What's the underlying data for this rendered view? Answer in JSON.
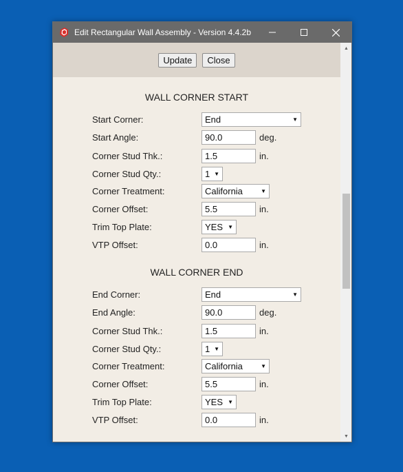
{
  "window": {
    "title": "Edit  Rectangular Wall Assembly - Version 4.4.2b"
  },
  "toolbar": {
    "update_label": "Update",
    "close_label": "Close"
  },
  "sections": {
    "start": {
      "title": "WALL CORNER START",
      "corner_label": "Start Corner:",
      "corner_value": "End",
      "angle_label": "Start Angle:",
      "angle_value": "90.0",
      "angle_unit": "deg.",
      "stud_thk_label": "Corner Stud Thk.:",
      "stud_thk_value": "1.5",
      "stud_thk_unit": "in.",
      "stud_qty_label": "Corner Stud Qty.:",
      "stud_qty_value": "1",
      "treatment_label": "Corner Treatment:",
      "treatment_value": "California",
      "offset_label": "Corner Offset:",
      "offset_value": "5.5",
      "offset_unit": "in.",
      "trim_label": "Trim Top Plate:",
      "trim_value": "YES",
      "vtp_label": "VTP Offset:",
      "vtp_value": "0.0",
      "vtp_unit": "in."
    },
    "end": {
      "title": "WALL CORNER END",
      "corner_label": "End Corner:",
      "corner_value": "End",
      "angle_label": "End Angle:",
      "angle_value": "90.0",
      "angle_unit": "deg.",
      "stud_thk_label": "Corner Stud Thk.:",
      "stud_thk_value": "1.5",
      "stud_thk_unit": "in.",
      "stud_qty_label": "Corner Stud Qty.:",
      "stud_qty_value": "1",
      "treatment_label": "Corner Treatment:",
      "treatment_value": "California",
      "offset_label": "Corner Offset:",
      "offset_value": "5.5",
      "offset_unit": "in.",
      "trim_label": "Trim Top Plate:",
      "trim_value": "YES",
      "vtp_label": "VTP Offset:",
      "vtp_value": "0.0",
      "vtp_unit": "in."
    }
  },
  "icons": {
    "app": "sketchup-icon",
    "minimize": "minimize-icon",
    "maximize": "maximize-icon",
    "close": "close-icon",
    "dropdown": "chevron-down-icon"
  },
  "colors": {
    "desktop": "#0a5fb4",
    "titlebar": "#6a6a6a",
    "toolbar": "#dcd5cc",
    "content": "#f2ede5",
    "app_icon": "#d9302c"
  }
}
